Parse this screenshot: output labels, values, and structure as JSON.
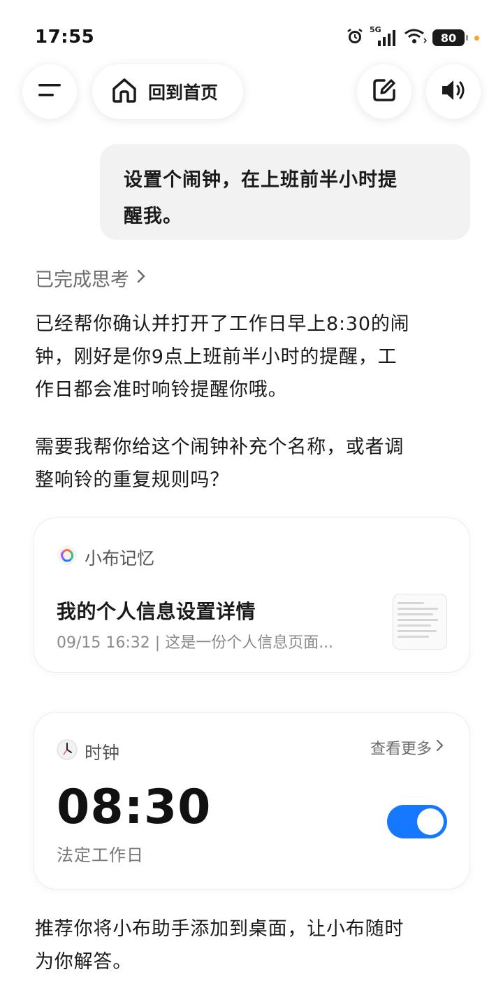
{
  "status_bar": {
    "time": "17:55",
    "battery": "80",
    "signal": "5G"
  },
  "top_bar": {
    "home_label": "回到首页"
  },
  "chat": {
    "user_message_line1": "设置个闹钟，在上班前半小时提",
    "user_message_line2": "醒我。",
    "thinking_label": "已完成思考",
    "reply_p1_line1": "已经帮你确认并打开了工作日早上8:30的闹",
    "reply_p1_line2": "钟，刚好是你9点上班前半小时的提醒，工",
    "reply_p1_line3": "作日都会准时响铃提醒你哦。",
    "reply_p2_line1": "需要我帮你给这个闹钟补充个名称，或者调",
    "reply_p2_line2": "整响铃的重复规则吗？",
    "reply_p3_line1": "推荐你将小布助手添加到桌面，让小布随时",
    "reply_p3_line2": "为你解答。"
  },
  "memory_card": {
    "app_name": "小布记忆",
    "title": "我的个人信息设置详情",
    "subtitle": "09/15 16:32 | 这是一份个人信息页面..."
  },
  "clock_card": {
    "app_name": "时钟",
    "more_label": "查看更多",
    "alarm_time": "08:30",
    "alarm_repeat": "法定工作日",
    "enabled": true
  },
  "colors": {
    "accent": "#1677ff",
    "battery_dot": "#f5a623"
  }
}
